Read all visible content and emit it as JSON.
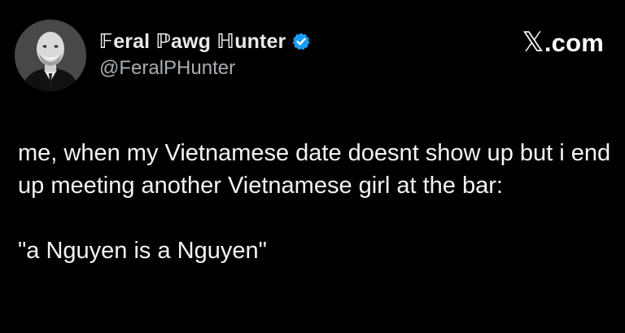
{
  "author": {
    "display_name": "𝔽eral ℙawg ℍunter",
    "handle": "@FeralPHunter",
    "verified": true,
    "verified_color": "#1d9bf0",
    "avatar_icon": "person-avatar"
  },
  "site": {
    "x_glyph": "𝕏",
    "domain_suffix": ".com"
  },
  "post": {
    "text": "me, when my Vietnamese date doesnt show up but i end up meeting another Vietnamese girl at the bar:\n\n\"a Nguyen is a Nguyen\""
  },
  "colors": {
    "background": "#000000",
    "text": "#e7e9ea",
    "handle": "#a8adb2"
  }
}
